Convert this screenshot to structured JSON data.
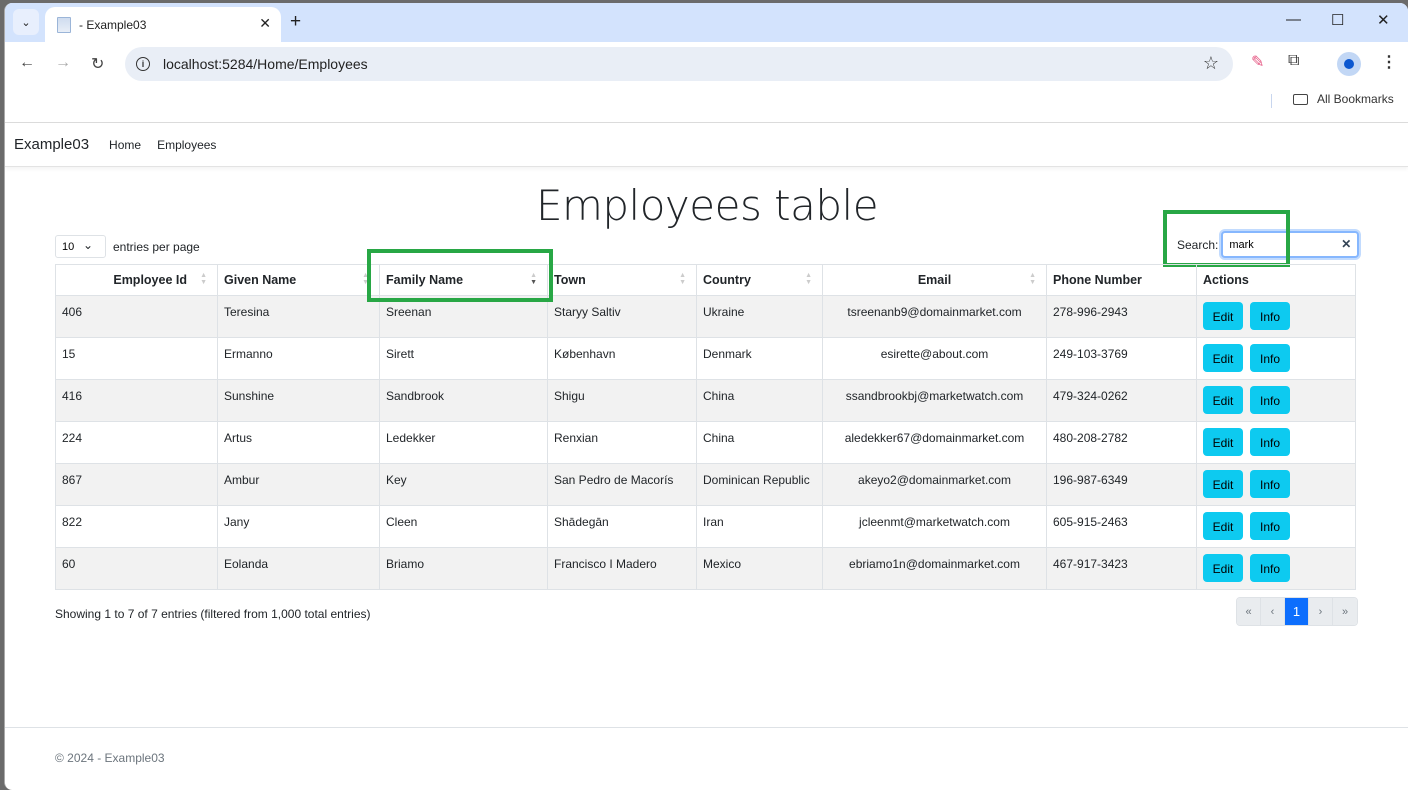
{
  "browser": {
    "tab_title": "- Example03",
    "url": "localhost:5284/Home/Employees",
    "bookmarks_label": "All Bookmarks"
  },
  "navbar": {
    "brand": "Example03",
    "links": [
      "Home",
      "Employees"
    ]
  },
  "page": {
    "title": "Employees table",
    "per_page_value": "10",
    "per_page_label": "entries per page",
    "search_label": "Search:",
    "search_value": "mark",
    "info": "Showing 1 to 7 of 7 entries (filtered from 1,000 total entries)",
    "footer": "© 2024 - Example03"
  },
  "table": {
    "columns": [
      "Employee Id",
      "Given Name",
      "Family Name",
      "Town",
      "Country",
      "Email",
      "Phone Number",
      "Actions"
    ],
    "sorted_column": "Family Name",
    "sort_direction": "descending",
    "rows": [
      {
        "id": "406",
        "given": "Teresina",
        "family": "Sreenan",
        "town": "Staryy Saltiv",
        "country": "Ukraine",
        "email": "tsreenanb9@domainmarket.com",
        "phone": "278-996-2943"
      },
      {
        "id": "15",
        "given": "Ermanno",
        "family": "Sirett",
        "town": "København",
        "country": "Denmark",
        "email": "esirette@about.com",
        "phone": "249-103-3769"
      },
      {
        "id": "416",
        "given": "Sunshine",
        "family": "Sandbrook",
        "town": "Shigu",
        "country": "China",
        "email": "ssandbrookbj@marketwatch.com",
        "phone": "479-324-0262"
      },
      {
        "id": "224",
        "given": "Artus",
        "family": "Ledekker",
        "town": "Renxian",
        "country": "China",
        "email": "aledekker67@domainmarket.com",
        "phone": "480-208-2782"
      },
      {
        "id": "867",
        "given": "Ambur",
        "family": "Key",
        "town": "San Pedro de Macorís",
        "country": "Dominican Republic",
        "email": "akeyo2@domainmarket.com",
        "phone": "196-987-6349"
      },
      {
        "id": "822",
        "given": "Jany",
        "family": "Cleen",
        "town": "Shādegān",
        "country": "Iran",
        "email": "jcleenmt@marketwatch.com",
        "phone": "605-915-2463"
      },
      {
        "id": "60",
        "given": "Eolanda",
        "family": "Briamo",
        "town": "Francisco I Madero",
        "country": "Mexico",
        "email": "ebriamo1n@domainmarket.com",
        "phone": "467-917-3423"
      }
    ],
    "edit_label": "Edit",
    "info_label": "Info"
  },
  "pagination": {
    "first": "«",
    "prev": "‹",
    "current": "1",
    "next": "›",
    "last": "»"
  },
  "colors": {
    "action_button": "#0dcaf0",
    "active_page": "#0d6efd",
    "highlight_box": "#28a745"
  }
}
